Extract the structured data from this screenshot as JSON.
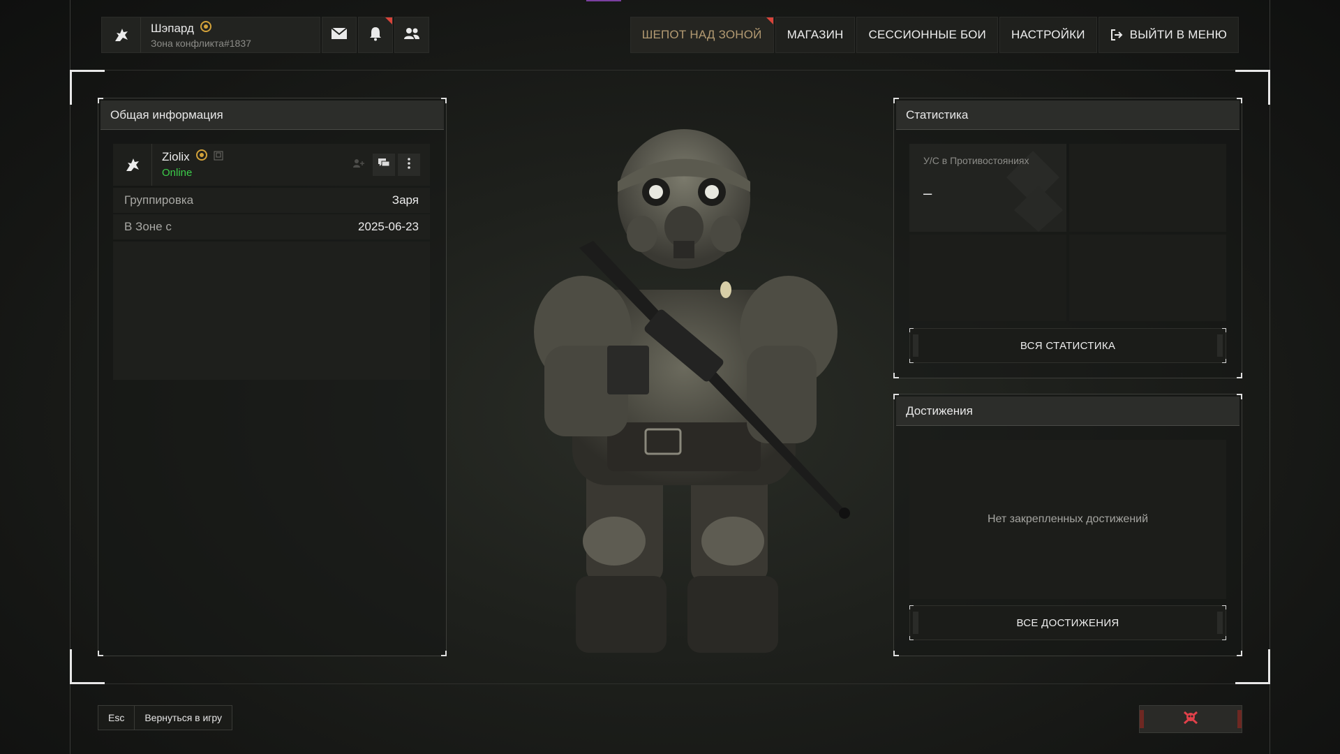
{
  "player": {
    "name": "Шэпард",
    "subtitle": "Зона конфликта#1837"
  },
  "nav": {
    "items": [
      {
        "label": "ШЕПОТ НАД ЗОНОЙ"
      },
      {
        "label": "МАГАЗИН"
      },
      {
        "label": "СЕССИОННЫЕ БОИ"
      },
      {
        "label": "НАСТРОЙКИ"
      },
      {
        "label": "ВЫЙТИ В МЕНЮ"
      }
    ]
  },
  "general": {
    "title": "Общая информация",
    "user_name": "Ziolix",
    "user_status": "Online",
    "rows": [
      {
        "key": "Группировка",
        "value": "Заря"
      },
      {
        "key": "В Зоне с",
        "value": "2025-06-23"
      }
    ]
  },
  "stats": {
    "title": "Статистика",
    "kd_label": "У/С в Противостояниях",
    "kd_value": "–",
    "all_button": "ВСЯ СТАТИСТИКА"
  },
  "achievements": {
    "title": "Достижения",
    "empty_text": "Нет закрепленных достижений",
    "all_button": "ВСЕ ДОСТИЖЕНИЯ"
  },
  "footer": {
    "esc_key": "Esc",
    "back_label": "Вернуться в игру"
  },
  "colors": {
    "accent_nav_active": "#b39a72",
    "online": "#3ccd4a",
    "alert": "#d9443a",
    "danger": "#e0414a"
  },
  "icons": [
    "wolf-logo-icon",
    "rank-badge-icon",
    "mail-icon",
    "bell-icon",
    "friends-icon",
    "exit-icon",
    "add-friend-icon",
    "chat-icon",
    "more-icon",
    "copy-icon",
    "skull-icon"
  ]
}
